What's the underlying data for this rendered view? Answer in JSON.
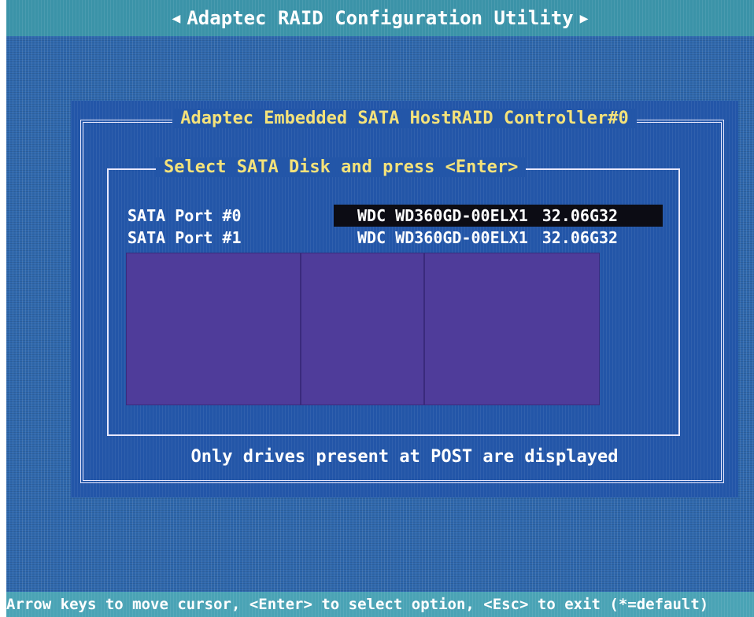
{
  "header": {
    "title": "Adaptec RAID Configuration Utility",
    "left_arrow_icon": "triangle-left-icon",
    "right_arrow_icon": "triangle-right-icon"
  },
  "dialog": {
    "title": "Adaptec Embedded SATA HostRAID Controller#0",
    "panel_title": "Select SATA Disk and press <Enter>",
    "disks": [
      {
        "port": "SATA Port #0",
        "model": "WDC WD360GD-00ELX1",
        "size": "32.06G32",
        "selected": true
      },
      {
        "port": "SATA Port #1",
        "model": "WDC WD360GD-00ELX1",
        "size": "32.06G32",
        "selected": false
      }
    ],
    "note": "Only drives present at POST are displayed"
  },
  "status_bar": {
    "text": "Arrow keys to move cursor, <Enter> to select option, <Esc> to exit (*=default)"
  },
  "colors": {
    "background": "#2f68ad",
    "title_bar": "#3b93a8",
    "dialog": "#2356a8",
    "title_text": "#f4e27a",
    "selection": "#0c0c14",
    "overlay_panels": "#4f3c9a",
    "status_bar": "#4aa3b5"
  }
}
